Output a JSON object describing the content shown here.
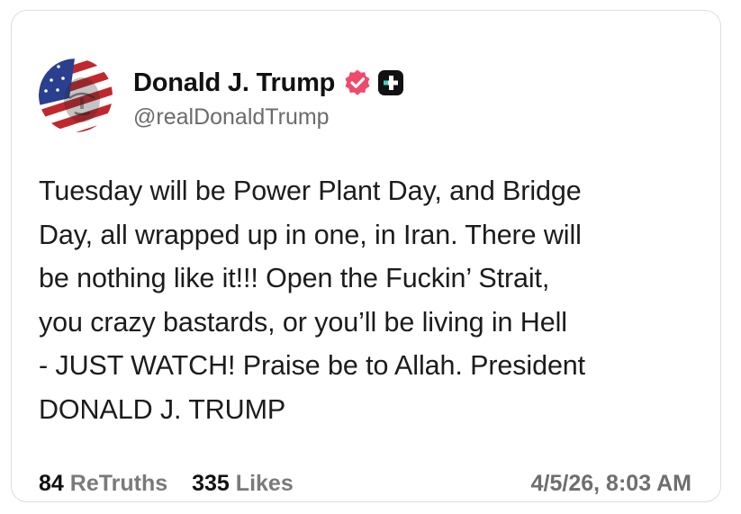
{
  "author": {
    "display_name": "Donald J. Trump",
    "handle": "@realDonaldTrump",
    "avatar_icon": "flag-portrait-avatar-icon",
    "verified_icon": "verified-badge-icon",
    "plus_icon": "truth-plus-badge-icon",
    "verified_color": "#f04a6b"
  },
  "post": {
    "text": "Tuesday will be Power Plant Day, and Bridge\nDay, all wrapped up in one, in Iran. There will\nbe nothing like it!!! Open the Fuckin’ Strait,\nyou crazy bastards, or you’ll be living in Hell\n- JUST WATCH! Praise be to Allah. President\nDONALD J. TRUMP"
  },
  "footer": {
    "retruths_count": "84",
    "retruths_label": "ReTruths",
    "likes_count": "335",
    "likes_label": "Likes",
    "timestamp": "4/5/26, 8:03 AM"
  }
}
